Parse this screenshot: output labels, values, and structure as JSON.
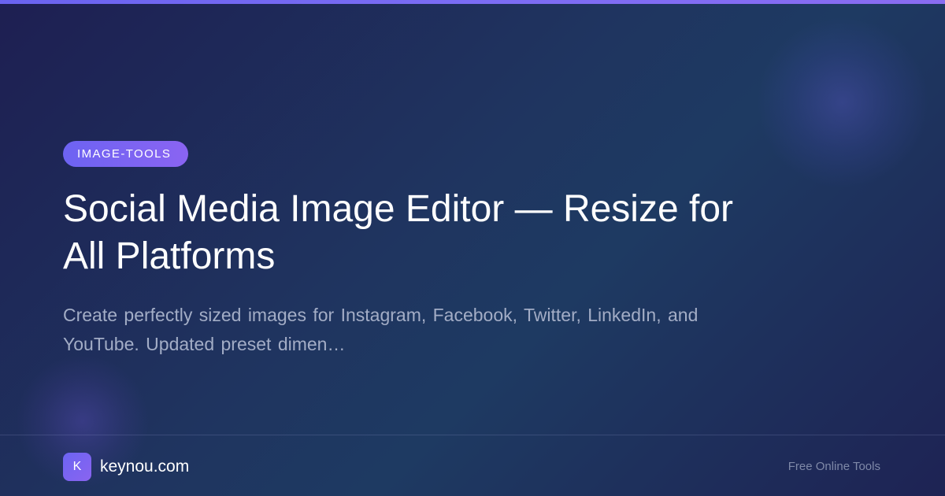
{
  "tag": "IMAGE-TOOLS",
  "title": "Social Media Image Editor — Resize for All Platforms",
  "description": "Create perfectly sized images for Instagram, Facebook, Twitter, LinkedIn, and YouTube. Updated preset dimen…",
  "footer": {
    "logo_letter": "K",
    "site": "keynou.com",
    "tagline": "Free Online Tools"
  },
  "colors": {
    "accent": "#7b6cf4",
    "background": "#1f3560",
    "muted_text": "#a3adc6"
  }
}
